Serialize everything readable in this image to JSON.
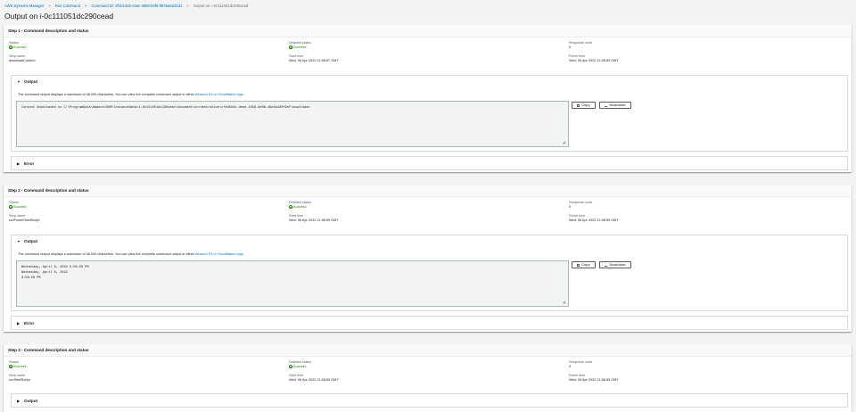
{
  "breadcrumb": [
    "AWS Systems Manager",
    "Run Command",
    "Command ID: 8f1b13a5-c0ac-4960-b0f8-f8f45a6a31d3",
    "Output on: i-0c111051dc290cead"
  ],
  "page_title": "Output on i-0c111051dc290cead",
  "labels": {
    "status": "Status",
    "detailed_status": "Detailed status",
    "response_code": "Response code",
    "step_name": "Step name",
    "start_time": "Start time",
    "finish_time": "Finish time",
    "output": "Output",
    "error": "Error",
    "copy": "Copy",
    "download": "Download",
    "truncation_note": "The command output displays a maximum of 48,000 characters. You can view the complete command output in either ",
    "truncation_link": "Amazon S3 or CloudWatch logs."
  },
  "steps": [
    {
      "title": "Step 1 - Command description and status",
      "status": "Success",
      "detailed_status": "Success",
      "response_code": "0",
      "step_name": "downloadContent",
      "start_time": "Wed, 06 Apr 2022 21:58:57 GMT",
      "finish_time": "Wed, 06 Apr 2022 21:58:59 GMT",
      "output_lines": [
        "Content downloaded to C:\\ProgramData\\Amazon\\SSM\\InstanceData\\i-0c111051dc290cead\\document\\orchestration\\cfb45e3c-deee-4459-8e08-48e3b420f9ef\\downloads"
      ]
    },
    {
      "title": "Step 2 - Command description and status",
      "status": "Success",
      "detailed_status": "Success",
      "response_code": "0",
      "step_name": "runPowerShellScript",
      "start_time": "Wed, 06 Apr 2022 21:58:59 GMT",
      "finish_time": "Wed, 06 Apr 2022 21:58:59 GMT",
      "output_lines": [
        "Wednesday, April 6, 2022 9:58:59 PM",
        "Wednesday, April 6, 2022",
        "9:58:59 PM"
      ]
    },
    {
      "title": "Step 3 - Command description and status",
      "status": "Success",
      "detailed_status": "Success",
      "response_code": "0",
      "step_name": "runShellScript",
      "start_time": "Wed, 06 Apr 2022 21:58:59 GMT",
      "finish_time": "Wed, 06 Apr 2022 21:58:59 GMT"
    }
  ]
}
